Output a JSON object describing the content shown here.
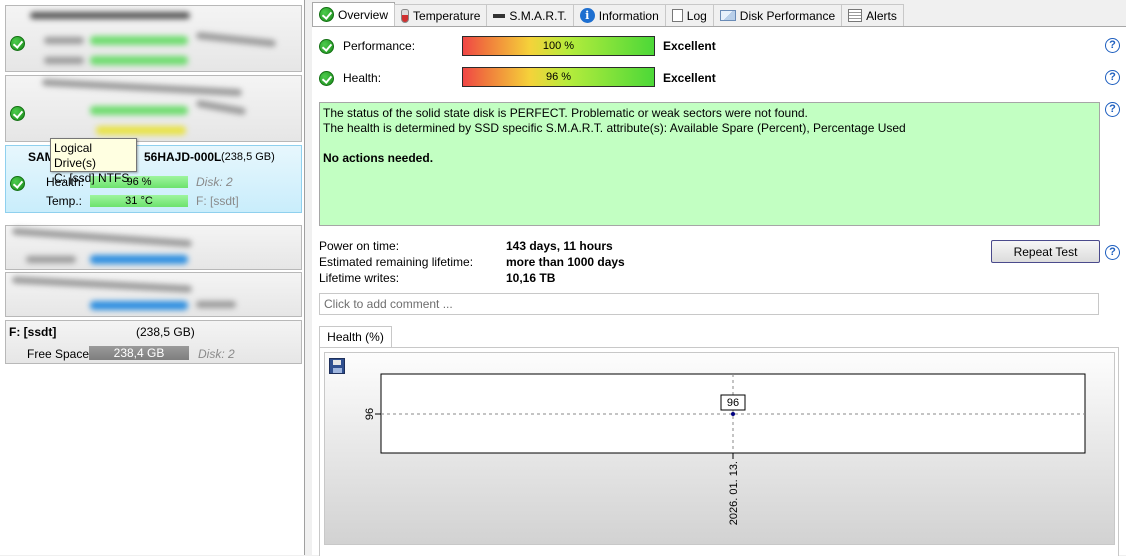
{
  "tooltip": {
    "line1": "Logical Drive(s)",
    "line2": "C: [ssd] NTFS"
  },
  "disks": {
    "sam": {
      "name": "SAM",
      "model_tail": "56HAJD-000L",
      "size": "(238,5 GB)",
      "health_label": "Health:",
      "health_value": "96 %",
      "disk_label": "Disk: 2",
      "temp_label": "Temp.:",
      "temp_value": "31 °C",
      "partition": "F: [ssdt]"
    },
    "partition": {
      "name": "F: [ssdt]",
      "size": "(238,5 GB)",
      "free_label": "Free Space",
      "free_value": "238,4 GB",
      "disk_label": "Disk: 2"
    }
  },
  "tabs": [
    {
      "label": "Overview",
      "icon": "check-icon"
    },
    {
      "label": "Temperature",
      "icon": "thermometer-icon"
    },
    {
      "label": "S.M.A.R.T.",
      "icon": "smart-icon"
    },
    {
      "label": "Information",
      "icon": "info-icon"
    },
    {
      "label": "Log",
      "icon": "document-icon"
    },
    {
      "label": "Disk Performance",
      "icon": "performance-icon"
    },
    {
      "label": "Alerts",
      "icon": "alerts-icon"
    }
  ],
  "overview": {
    "performance_label": "Performance:",
    "performance_value": "100 %",
    "performance_percent": 100,
    "performance_rating": "Excellent",
    "health_label": "Health:",
    "health_value": "96 %",
    "health_percent": 96,
    "health_rating": "Excellent",
    "status_line1": "The status of the solid state disk is PERFECT. Problematic or weak sectors were not found.",
    "status_line2": "The health is determined by SSD specific S.M.A.R.T. attribute(s):  Available Spare (Percent), Percentage Used",
    "status_action": "No actions needed.",
    "power_on_label": "Power on time:",
    "power_on_value": "143 days, 11 hours",
    "remaining_label": "Estimated remaining lifetime:",
    "remaining_value": "more than 1000 days",
    "writes_label": "Lifetime writes:",
    "writes_value": "10,16 TB",
    "repeat_button": "Repeat Test",
    "comment_placeholder": "Click to add comment ..."
  },
  "chart_tab": "Health (%)",
  "chart_data": {
    "type": "line",
    "x": [
      "2026. 01. 13."
    ],
    "series": [
      {
        "values": [
          96
        ]
      }
    ],
    "ytick": "96",
    "data_label": "96"
  }
}
